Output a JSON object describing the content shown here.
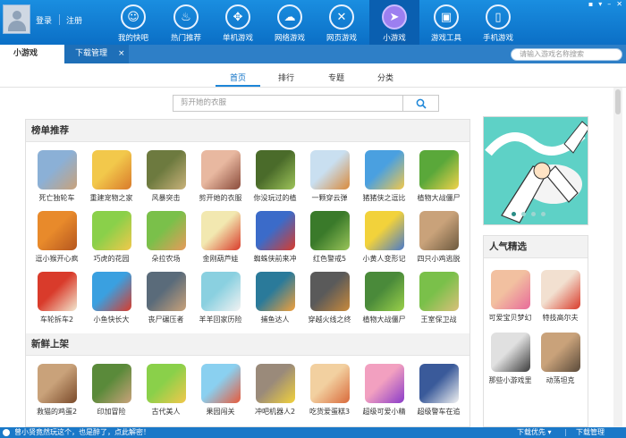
{
  "header": {
    "login": "登录",
    "register": "注册",
    "nav": [
      {
        "label": "我的快吧",
        "icon": "user-circle-icon",
        "glyph": "☺"
      },
      {
        "label": "热门推荐",
        "icon": "flame-icon",
        "glyph": "♨"
      },
      {
        "label": "单机游戏",
        "icon": "gamepad-icon",
        "glyph": "✥"
      },
      {
        "label": "网络游戏",
        "icon": "cloud-icon",
        "glyph": "☁"
      },
      {
        "label": "网页游戏",
        "icon": "crossed-swords-icon",
        "glyph": "✕"
      },
      {
        "label": "小游戏",
        "icon": "cursor-icon",
        "glyph": "➤"
      },
      {
        "label": "游戏工具",
        "icon": "toolbox-icon",
        "glyph": "▣"
      },
      {
        "label": "手机游戏",
        "icon": "mobile-phone-icon",
        "glyph": "▯"
      }
    ],
    "window_controls": [
      "▪",
      "▾",
      "–",
      "✕"
    ]
  },
  "tabs": {
    "minigames": "小游戏",
    "download": "下载管理",
    "close": "×",
    "search_placeholder": "请输入游戏名称搜索"
  },
  "subnav": [
    "首页",
    "排行",
    "专题",
    "分类"
  ],
  "main_search": {
    "placeholder": "剪开她的衣服"
  },
  "ranking": {
    "title": "榜单推荐",
    "games": [
      {
        "name": "死亡独轮车",
        "colors": [
          "#8bb0d6",
          "#c9a27a"
        ]
      },
      {
        "name": "重建宠物之家",
        "colors": [
          "#f2c84b",
          "#d97a2b"
        ]
      },
      {
        "name": "风暴突击",
        "colors": [
          "#6d7a3f",
          "#c9b27a"
        ]
      },
      {
        "name": "剪开她的衣服",
        "colors": [
          "#e8b8a0",
          "#8a4b3b"
        ]
      },
      {
        "name": "你没玩过的植",
        "colors": [
          "#4a6b2a",
          "#9ec45a"
        ]
      },
      {
        "name": "一颗穿云弹",
        "colors": [
          "#c9dff0",
          "#d98a3b"
        ]
      },
      {
        "name": "猪猪侠之逗比",
        "colors": [
          "#4aa0e0",
          "#f2c84b"
        ]
      },
      {
        "name": "植物大战僵尸",
        "colors": [
          "#5aa83a",
          "#f2d24b"
        ]
      },
      {
        "name": "逗小猴开心疯",
        "colors": [
          "#e88a2b",
          "#b5561f"
        ]
      },
      {
        "name": "巧虎的花园",
        "colors": [
          "#8ad04a",
          "#f2c84b"
        ]
      },
      {
        "name": "朵拉农场",
        "colors": [
          "#7ac04a",
          "#e89a5a"
        ]
      },
      {
        "name": "金刚葫芦娃",
        "colors": [
          "#f2e8b0",
          "#d93b2b"
        ]
      },
      {
        "name": "蜘蛛侠前来冲",
        "colors": [
          "#3b6bc9",
          "#d93b2b"
        ]
      },
      {
        "name": "红色警戒5",
        "colors": [
          "#3a7a2a",
          "#9ac45a"
        ]
      },
      {
        "name": "小黄人变形记",
        "colors": [
          "#f2d23b",
          "#4a7ac9"
        ]
      },
      {
        "name": "四只小鸡逃脱",
        "colors": [
          "#c9a27a",
          "#6d5a3f"
        ]
      },
      {
        "name": "车轮拆车2",
        "colors": [
          "#d93b2b",
          "#f2e8d0"
        ]
      },
      {
        "name": "小鱼快长大",
        "colors": [
          "#3aa0e0",
          "#d93b2b"
        ]
      },
      {
        "name": "丧尸碾压者",
        "colors": [
          "#5a6b7a",
          "#c9a27a"
        ]
      },
      {
        "name": "羊羊回家历险",
        "colors": [
          "#8ad0e0",
          "#f2f2f2"
        ]
      },
      {
        "name": "捕鱼达人",
        "colors": [
          "#2a7a9a",
          "#f2a03b"
        ]
      },
      {
        "name": "穿越火线之终",
        "colors": [
          "#5a5a5a",
          "#c98a3b"
        ]
      },
      {
        "name": "植物大战僵尸",
        "colors": [
          "#4a8a3a",
          "#9ad04a"
        ]
      },
      {
        "name": "王室保卫战",
        "colors": [
          "#7ac04a",
          "#d9c07a"
        ]
      }
    ]
  },
  "fresh": {
    "title": "新鲜上架",
    "games": [
      {
        "name": "救猫的鸡蛋2",
        "colors": [
          "#c9a27a",
          "#7a4a2a"
        ]
      },
      {
        "name": "印加冒险",
        "colors": [
          "#5a8a3a",
          "#c9a27a"
        ]
      },
      {
        "name": "古代美人",
        "colors": [
          "#8ad04a",
          "#f2c84b"
        ]
      },
      {
        "name": "果园闯关",
        "colors": [
          "#8ad0f0",
          "#e85a3b"
        ]
      },
      {
        "name": "冲吧机器人2",
        "colors": [
          "#9a8a7a",
          "#f2d23b"
        ]
      },
      {
        "name": "吃货爱蛋糕3",
        "colors": [
          "#f2d0a0",
          "#d96a3b"
        ]
      },
      {
        "name": "超级可爱小精",
        "colors": [
          "#f2a0c0",
          "#8a3bc9"
        ]
      },
      {
        "name": "超级警车在追",
        "colors": [
          "#3a5a9a",
          "#f2f2f2"
        ]
      }
    ]
  },
  "popular": {
    "title": "人气精选",
    "games": [
      {
        "name": "可爱宝贝梦幻",
        "colors": [
          "#f2c0a0",
          "#e86a9a"
        ]
      },
      {
        "name": "特技高尔夫",
        "colors": [
          "#f2e0d0",
          "#d93b2b"
        ]
      },
      {
        "name": "那些小游戏里",
        "colors": [
          "#e0e0e0",
          "#3b3b3b"
        ]
      },
      {
        "name": "动荡坦克",
        "colors": [
          "#c9a27a",
          "#5a4a3a"
        ]
      }
    ]
  },
  "status": {
    "message": "曾小贤竟然玩这个，也是醉了，点此解密！",
    "dl_priority": "下载优先 ▾",
    "dl_manage": "下载管理"
  }
}
